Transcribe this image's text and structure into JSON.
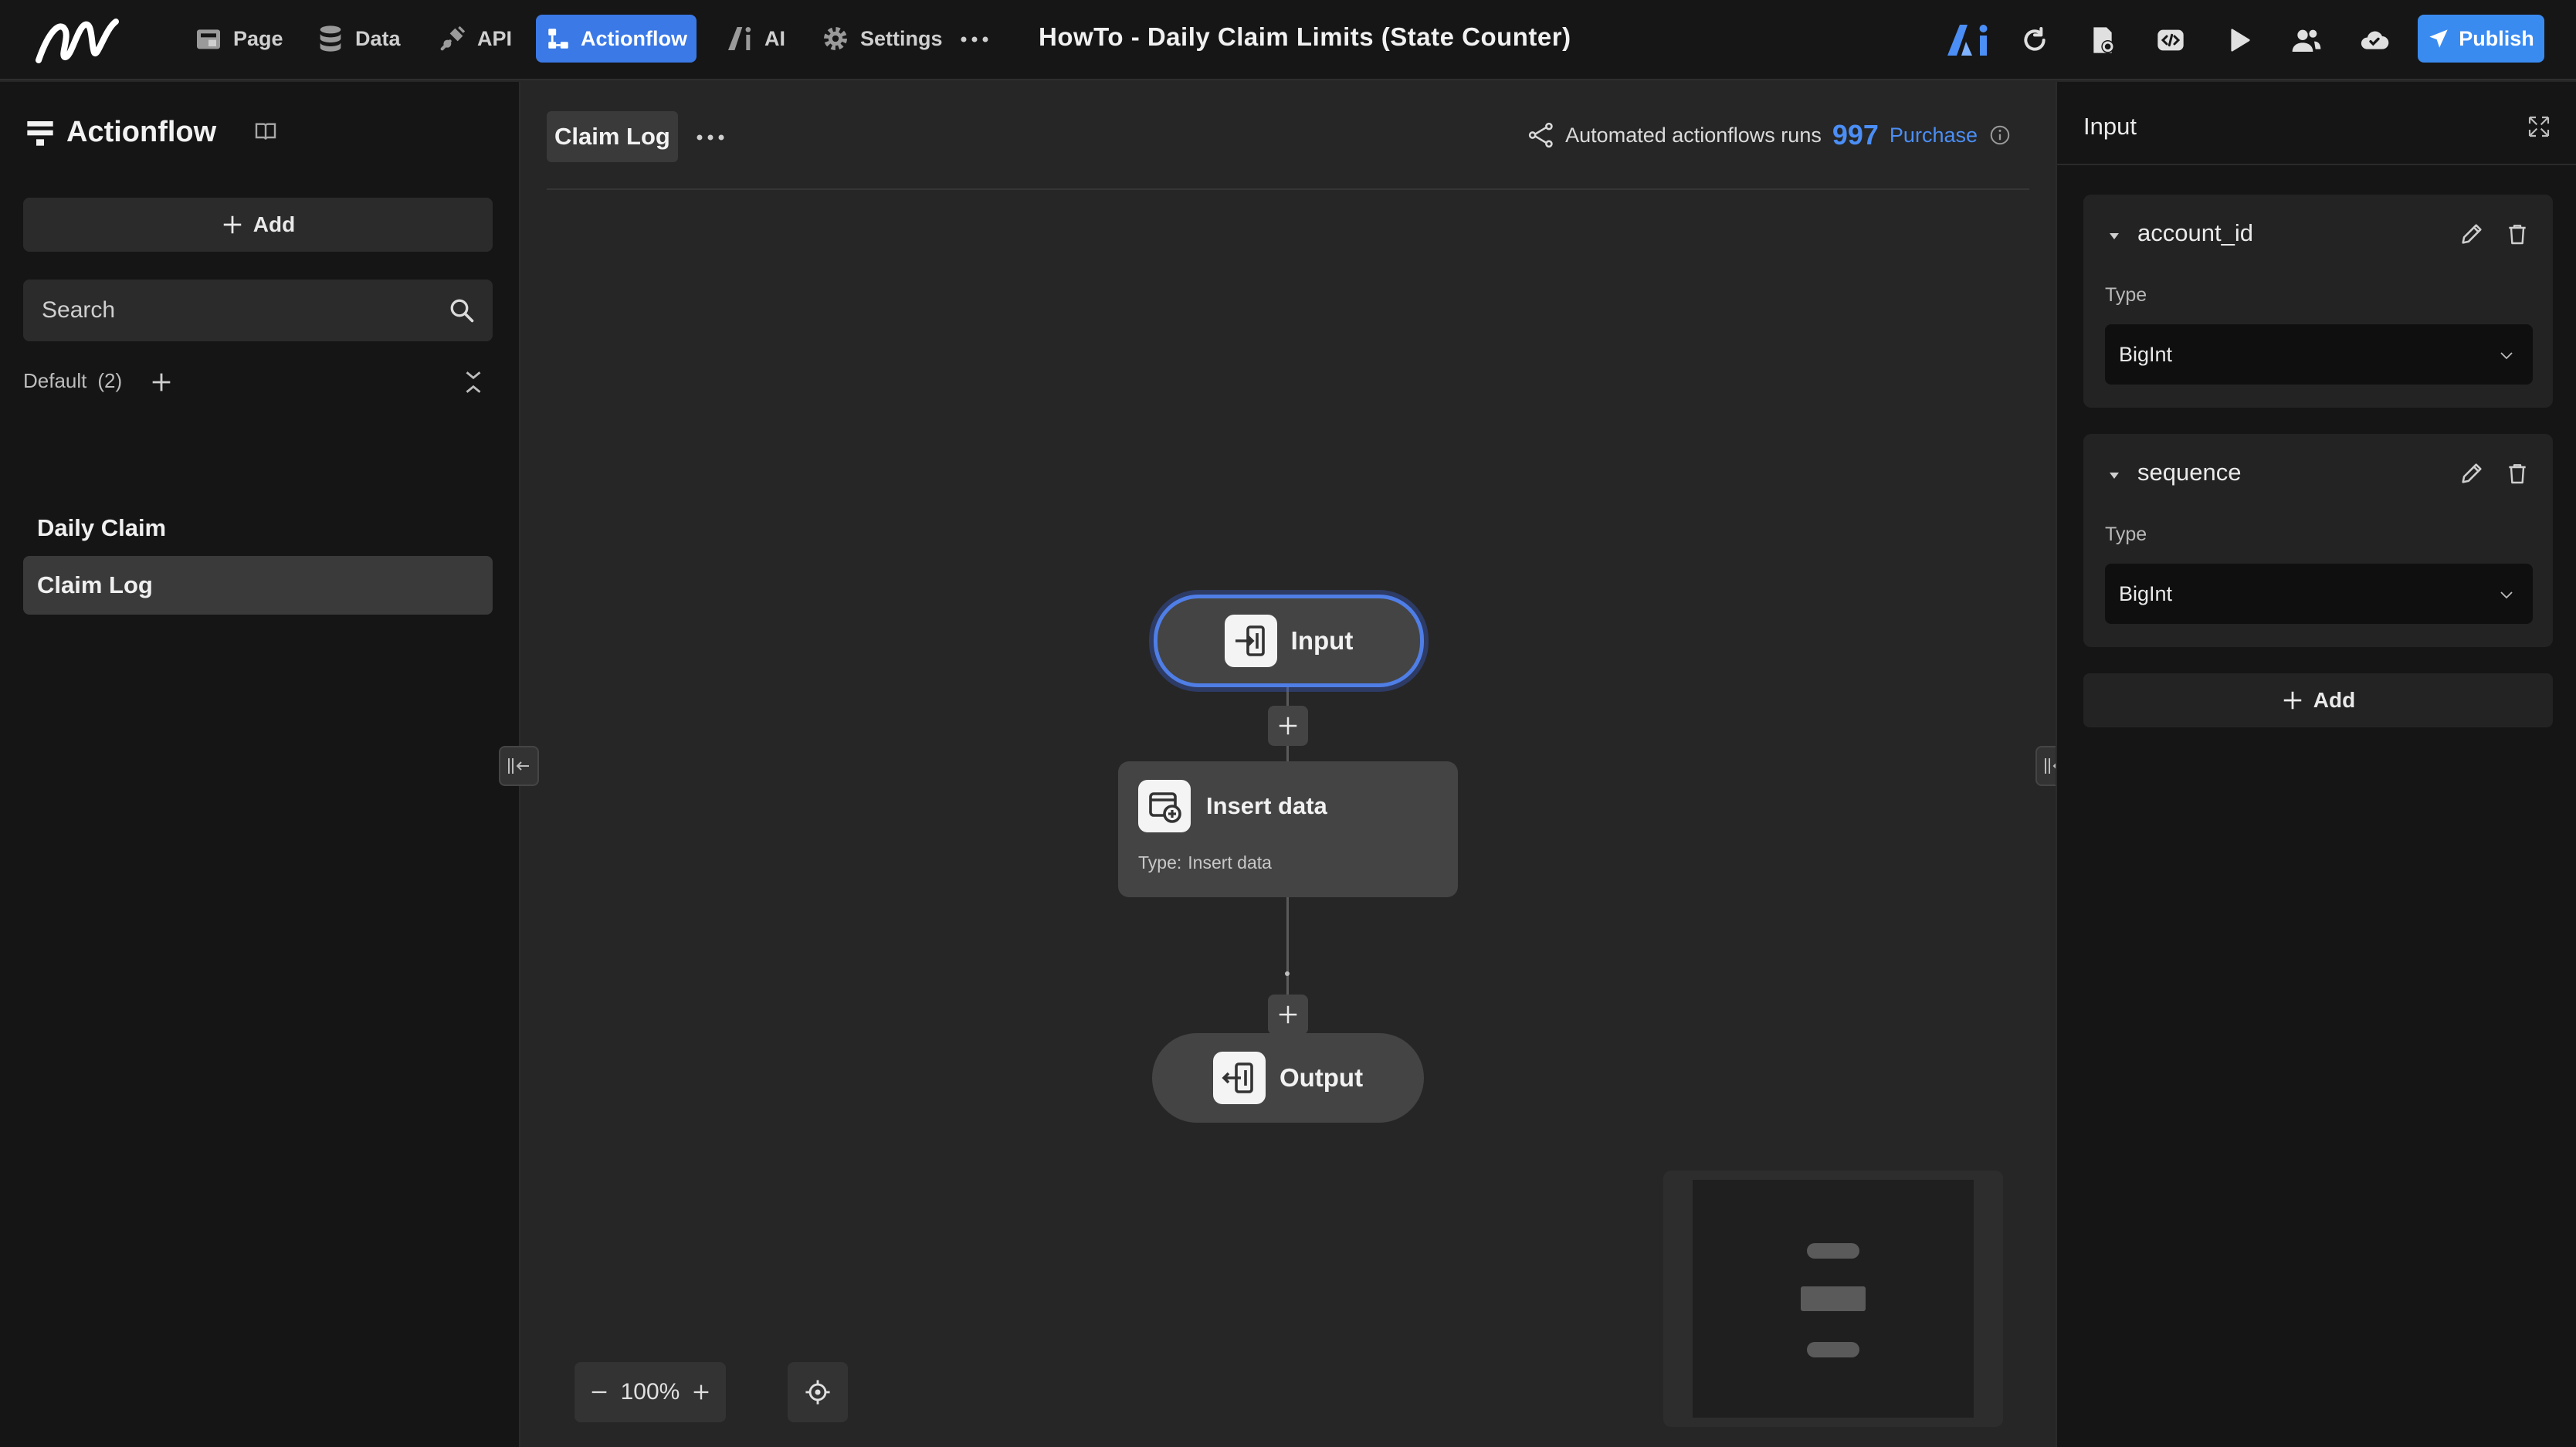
{
  "topbar": {
    "nav": [
      {
        "label": "Page",
        "icon": "page-icon"
      },
      {
        "label": "Data",
        "icon": "database-icon"
      },
      {
        "label": "API",
        "icon": "api-plug-icon"
      },
      {
        "label": "Actionflow",
        "icon": "actionflow-icon",
        "active": true
      },
      {
        "label": "AI",
        "icon": "ai-icon"
      },
      {
        "label": "Settings",
        "icon": "gear-icon"
      }
    ],
    "project_title": "HowTo - Daily Claim Limits (State Counter)",
    "publish_label": "Publish"
  },
  "sidebar": {
    "title": "Actionflow",
    "add_label": "Add",
    "search_placeholder": "Search",
    "group_name": "Default",
    "group_count": "(2)",
    "items": [
      {
        "label": "Daily Claim"
      },
      {
        "label": "Claim Log",
        "active": true
      }
    ]
  },
  "canvas": {
    "flow_tab": "Claim Log",
    "runs_label": "Automated actionflows runs",
    "runs_count": "997",
    "purchase_label": "Purchase",
    "nodes": {
      "input": "Input",
      "insert": {
        "title": "Insert data",
        "type_label": "Type:",
        "type_value": "Insert data"
      },
      "output": "Output"
    },
    "zoom": "100%"
  },
  "panel": {
    "title": "Input",
    "type_label": "Type",
    "fields": [
      {
        "name": "account_id",
        "type": "BigInt"
      },
      {
        "name": "sequence",
        "type": "BigInt"
      }
    ],
    "add_label": "Add"
  },
  "colors": {
    "accent": "#3a79e6",
    "publish": "#3a8bf0",
    "runs_count": "#4b8ef5",
    "selected_border": "#4f7ee6"
  }
}
